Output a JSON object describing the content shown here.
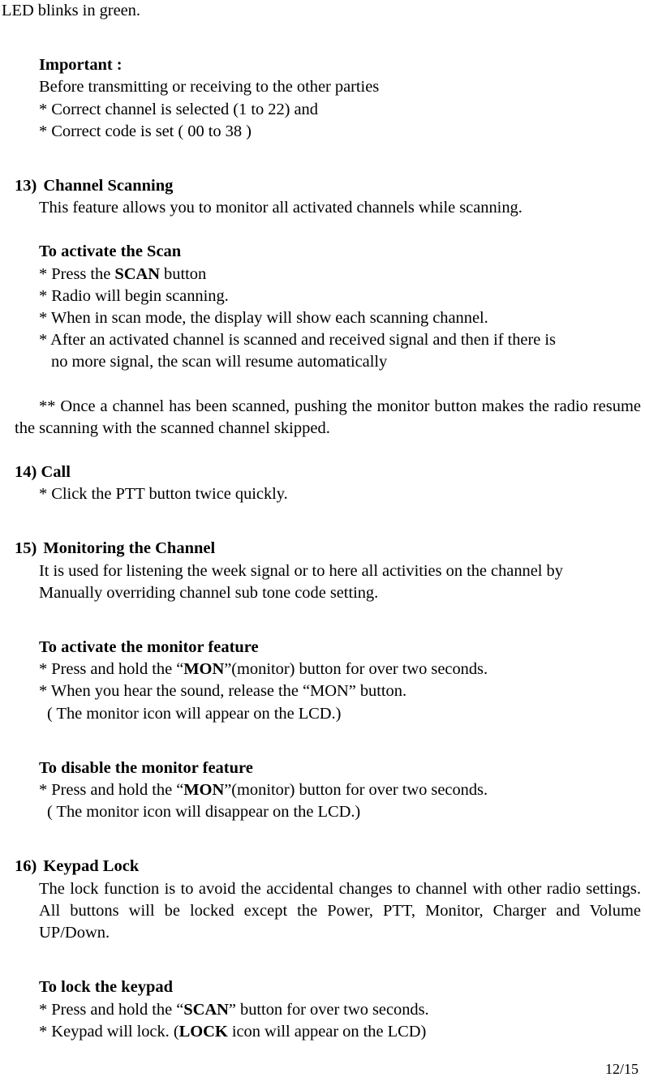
{
  "document": {
    "page_number": "12/15",
    "intro_line": "LED blinks in green.",
    "important_block": {
      "heading": "Important :",
      "lines": [
        "Before transmitting or receiving to the other parties",
        "* Correct channel is selected (1 to 22) and",
        "* Correct code is set ( 00 to 38 )"
      ]
    },
    "sections": [
      {
        "number": "13)",
        "title": "Channel Scanning",
        "intro": "This feature allows you to monitor all activated channels while scanning.",
        "sub_heading": "To activate the Scan",
        "bullets": [
          {
            "pre": "* Press the ",
            "bold": "SCAN",
            "post": " button"
          },
          {
            "pre": "* Radio will begin scanning.",
            "bold": "",
            "post": ""
          },
          {
            "pre": "* When in scan mode, the display will show each scanning channel.",
            "bold": "",
            "post": ""
          },
          {
            "pre": "* After an activated channel is scanned and received signal and then if there is",
            "bold": "",
            "post": ""
          }
        ],
        "bullet_continuation": "no more signal, the scan will resume automatically",
        "note": "** Once a channel has been scanned, pushing the monitor button makes the radio resume the scanning with the scanned channel skipped."
      },
      {
        "number": "14)",
        "title": "Call",
        "bullets": [
          {
            "pre": "* Click the PTT button twice quickly.",
            "bold": "",
            "post": ""
          }
        ]
      },
      {
        "number": "15)",
        "title": "Monitoring the Channel",
        "intro_line_1": "It is used for listening the week signal or to here all activities on the channel by",
        "intro_line_2": "Manually overriding channel sub tone code setting.",
        "activate": {
          "sub_heading": "To activate the monitor feature",
          "bullet_1": {
            "pre": "* Press and hold the “",
            "bold": "MON",
            "post": "”(monitor) button for over two seconds."
          },
          "bullet_2": "* When you hear the sound, release the “MON” button.",
          "paren": "( The monitor icon will appear on the LCD.)"
        },
        "disable": {
          "sub_heading": "To disable the monitor feature",
          "bullet_1": {
            "pre": "* Press and hold the “",
            "bold": "MON",
            "post": "”(monitor) button for over two seconds."
          },
          "paren": "( The monitor icon will disappear on the LCD.)"
        }
      },
      {
        "number": "16)",
        "title": "Keypad Lock",
        "intro": "The lock function is to avoid the accidental changes to channel with other radio settings. All buttons will be locked except the Power, PTT, Monitor, Charger and Volume UP/Down.",
        "lock": {
          "sub_heading": "To lock the keypad",
          "bullet_1": {
            "pre": "* Press and hold the “",
            "bold": "SCAN",
            "post": "” button for over two seconds."
          },
          "bullet_2": {
            "pre": "* Keypad will lock. (",
            "bold": "LOCK",
            "post": " icon will appear on the LCD)"
          }
        }
      }
    ]
  }
}
